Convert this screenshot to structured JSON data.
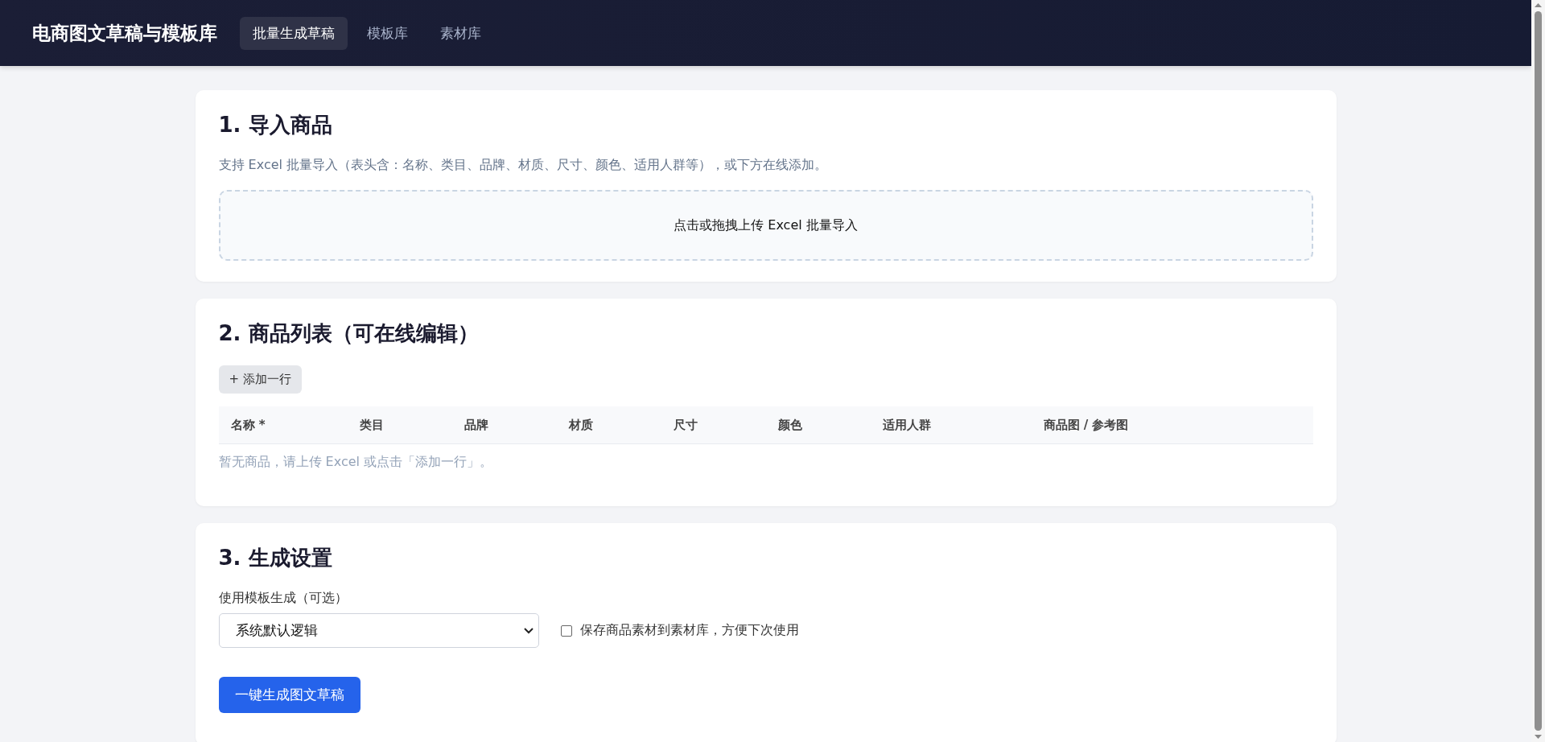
{
  "header": {
    "brand": "电商图文草稿与模板库",
    "tabs": [
      {
        "label": "批量生成草稿",
        "selected": true
      },
      {
        "label": "模板库",
        "selected": false
      },
      {
        "label": "素材库",
        "selected": false
      }
    ]
  },
  "import_section": {
    "title": "1. 导入商品",
    "description": "支持 Excel 批量导入（表头含：名称、类目、品牌、材质、尺寸、颜色、适用人群等），或下方在线添加。",
    "dropzone": "点击或拖拽上传 Excel 批量导入"
  },
  "list_section": {
    "title": "2. 商品列表（可在线编辑）",
    "add_button": "+ 添加一行",
    "table": {
      "columns": [
        "名称 *",
        "类目",
        "品牌",
        "材质",
        "尺寸",
        "颜色",
        "适用人群",
        "商品图 / 参考图"
      ],
      "empty": "暂无商品，请上传 Excel 或点击「添加一行」。"
    }
  },
  "settings_section": {
    "title": "3. 生成设置",
    "template_label": "使用模板生成（可选）",
    "template_value": "系统默认逻辑",
    "save_option": {
      "label": "保存商品素材到素材库，方便下次使用",
      "checked": false
    },
    "generate_button": "一键生成图文草稿"
  }
}
